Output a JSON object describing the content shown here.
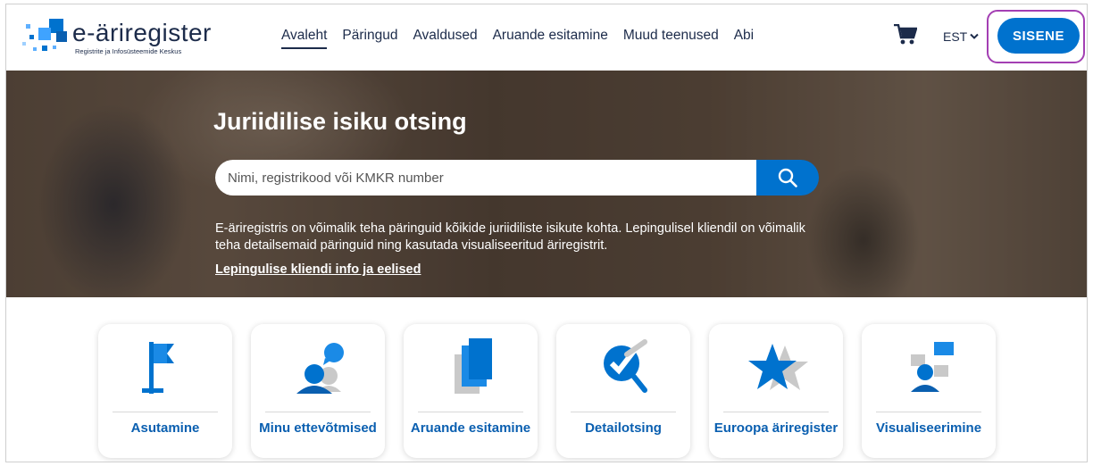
{
  "header": {
    "logo_text": "e-äriregister",
    "logo_sub": "Registrite ja Infosüsteemide Keskus",
    "nav": [
      {
        "label": "Avaleht",
        "active": true
      },
      {
        "label": "Päringud"
      },
      {
        "label": "Avaldused"
      },
      {
        "label": "Aruande esitamine"
      },
      {
        "label": "Muud teenused"
      },
      {
        "label": "Abi"
      }
    ],
    "cart_icon": "shopping-cart-icon",
    "language": "EST",
    "login_label": "SISENE"
  },
  "hero": {
    "title": "Juriidilise isiku otsing",
    "search_placeholder": "Nimi, registrikood või KMKR number",
    "search_icon": "search-icon",
    "description": "E-äriregistris on võimalik teha päringuid kõikide juriidiliste isikute kohta. Lepingulisel kliendil on võimalik teha detailsemaid päringuid ning kasutada visualiseeritud äriregistrit.",
    "link": "Lepingulise kliendi info ja eelised"
  },
  "cards": [
    {
      "label": "Asutamine",
      "icon": "flag-icon"
    },
    {
      "label": "Minu ettevõtmised",
      "icon": "user-chat-icon"
    },
    {
      "label": "Aruande esitamine",
      "icon": "documents-icon"
    },
    {
      "label": "Detailotsing",
      "icon": "magnifier-check-icon"
    },
    {
      "label": "Euroopa äriregister",
      "icon": "star-icon"
    },
    {
      "label": "Visualiseerimine",
      "icon": "user-visual-icon"
    }
  ],
  "colors": {
    "accent": "#0072ce",
    "text_dark": "#1c2b4a",
    "highlight_ring": "#a33fb3"
  }
}
